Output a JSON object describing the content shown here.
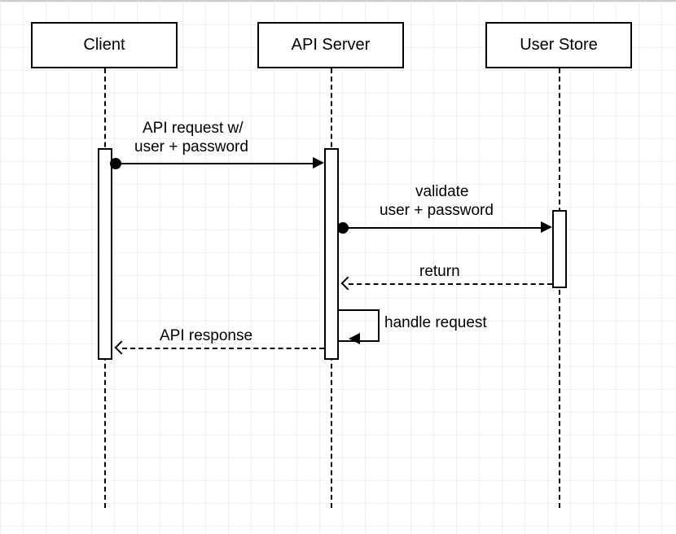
{
  "participants": {
    "client": "Client",
    "api_server": "API Server",
    "user_store": "User Store"
  },
  "messages": {
    "api_request_l1": "API request w/",
    "api_request_l2": "user + password",
    "validate_l1": "validate",
    "validate_l2": "user + password",
    "return": "return",
    "handle_request": "handle request",
    "api_response": "API response"
  }
}
